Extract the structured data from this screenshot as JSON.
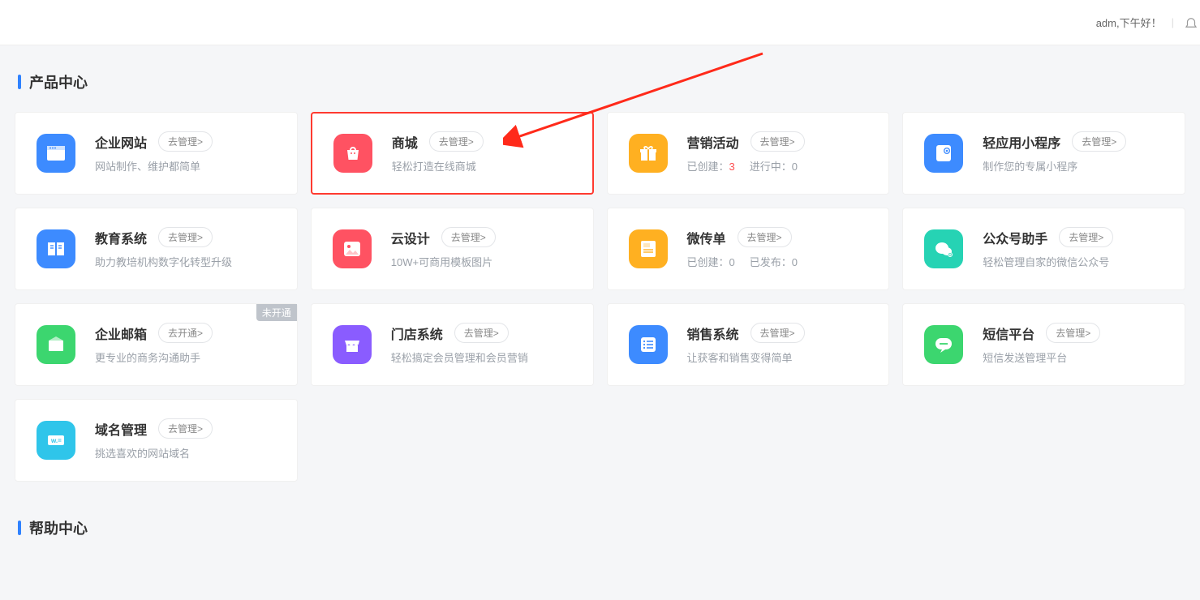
{
  "header": {
    "greeting": "adm,下午好！"
  },
  "sections": {
    "products": "产品中心",
    "help": "帮助中心"
  },
  "btn_manage": "去管理>",
  "btn_open": "去开通>",
  "tag_not_open": "未开通",
  "cards": [
    {
      "title": "企业网站",
      "sub_text": "网站制作、维护都简单",
      "btn": "manage",
      "icon": "website",
      "color": "#3d8bff"
    },
    {
      "title": "商城",
      "sub_text": "轻松打造在线商城",
      "btn": "manage",
      "icon": "bag",
      "color": "#ff5262",
      "highlight": true
    },
    {
      "title": "营销活动",
      "btn": "manage",
      "icon": "gift",
      "color": "#ffb021",
      "stats": [
        {
          "label": "已创建：",
          "value": "3",
          "red": true
        },
        {
          "label": "进行中：",
          "value": "0"
        }
      ]
    },
    {
      "title": "轻应用小程序",
      "sub_text": "制作您的专属小程序",
      "btn": "manage",
      "icon": "miniapp",
      "color": "#3d8bff"
    },
    {
      "title": "教育系统",
      "sub_text": "助力教培机构数字化转型升级",
      "btn": "manage",
      "icon": "book",
      "color": "#3d8bff"
    },
    {
      "title": "云设计",
      "sub_text": "10W+可商用模板图片",
      "btn": "manage",
      "icon": "image",
      "color": "#ff5262"
    },
    {
      "title": "微传单",
      "btn": "manage",
      "icon": "flyer",
      "color": "#ffb021",
      "stats": [
        {
          "label": "已创建：",
          "value": "0"
        },
        {
          "label": "已发布：",
          "value": "0"
        }
      ]
    },
    {
      "title": "公众号助手",
      "sub_text": "轻松管理自家的微信公众号",
      "btn": "manage",
      "icon": "wechat",
      "color": "#26d3b4"
    },
    {
      "title": "企业邮箱",
      "sub_text": "更专业的商务沟通助手",
      "btn": "open",
      "tag": "not_open",
      "icon": "mail",
      "color": "#3cd66f"
    },
    {
      "title": "门店系统",
      "sub_text": "轻松搞定会员管理和会员营销",
      "btn": "manage",
      "icon": "store",
      "color": "#8a5cff"
    },
    {
      "title": "销售系统",
      "sub_text": "让获客和销售变得简单",
      "btn": "manage",
      "icon": "list",
      "color": "#3d8bff"
    },
    {
      "title": "短信平台",
      "sub_text": "短信发送管理平台",
      "btn": "manage",
      "icon": "chat",
      "color": "#3cd66f"
    },
    {
      "title": "域名管理",
      "sub_text": "挑选喜欢的网站域名",
      "btn": "manage",
      "icon": "domain",
      "color": "#2fc5ea"
    }
  ]
}
